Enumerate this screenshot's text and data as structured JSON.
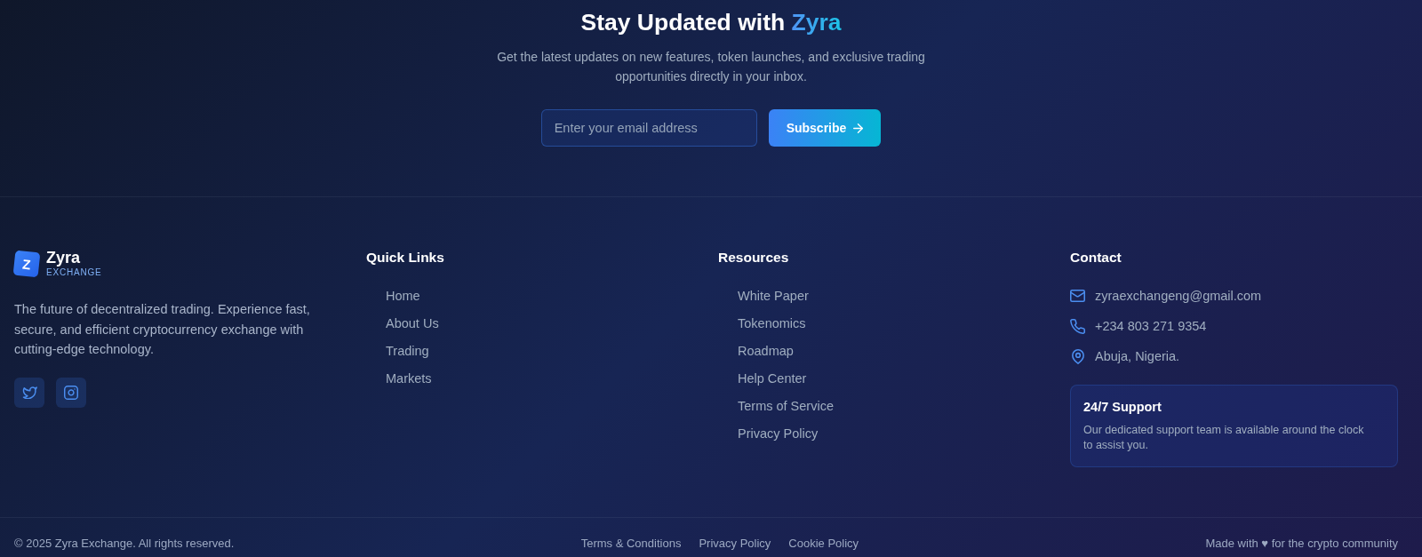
{
  "newsletter": {
    "title": "Stay Updated with",
    "title_accent": "Zyra",
    "description": "Get the latest updates on new features, token launches, and exclusive trading opportunities directly in your inbox.",
    "email_field": {
      "placeholder": "Enter your email address"
    },
    "subscribe_button": {
      "label": "Subscribe"
    }
  },
  "brand": {
    "logo_mark": "Z",
    "name": "Zyra",
    "tagline": "EXCHANGE",
    "description": "The future of decentralized trading. Experience fast, secure, and efficient cryptocurrency exchange with cutting-edge technology.",
    "social_links": [
      {
        "kind": "twitter"
      },
      {
        "kind": "instagram"
      }
    ]
  },
  "quick_links": {
    "title": "Quick Links",
    "links": [
      "Home",
      "About Us",
      "Trading",
      "Markets"
    ]
  },
  "resources": {
    "title": "Resources",
    "links": [
      "White Paper",
      "Tokenomics",
      "Roadmap",
      "Help Center",
      "Terms of Service",
      "Privacy Policy"
    ]
  },
  "contact": {
    "title": "Contact",
    "items": [
      {
        "kind": "email",
        "text": "zyraexchangeng@gmail.com"
      },
      {
        "kind": "phone",
        "text": "+234 803 271 9354"
      },
      {
        "kind": "location",
        "text": "Abuja, Nigeria."
      }
    ],
    "support_card": {
      "title": "24/7 Support",
      "text": "Our dedicated support team is available around the clock to assist you."
    }
  },
  "bottom_bar": {
    "copyright": "© 2025 Zyra Exchange. All rights reserved.",
    "links": [
      "Terms & Conditions",
      "Privacy Policy",
      "Cookie Policy"
    ],
    "tagline": "Made with ♥ for the crypto community"
  }
}
